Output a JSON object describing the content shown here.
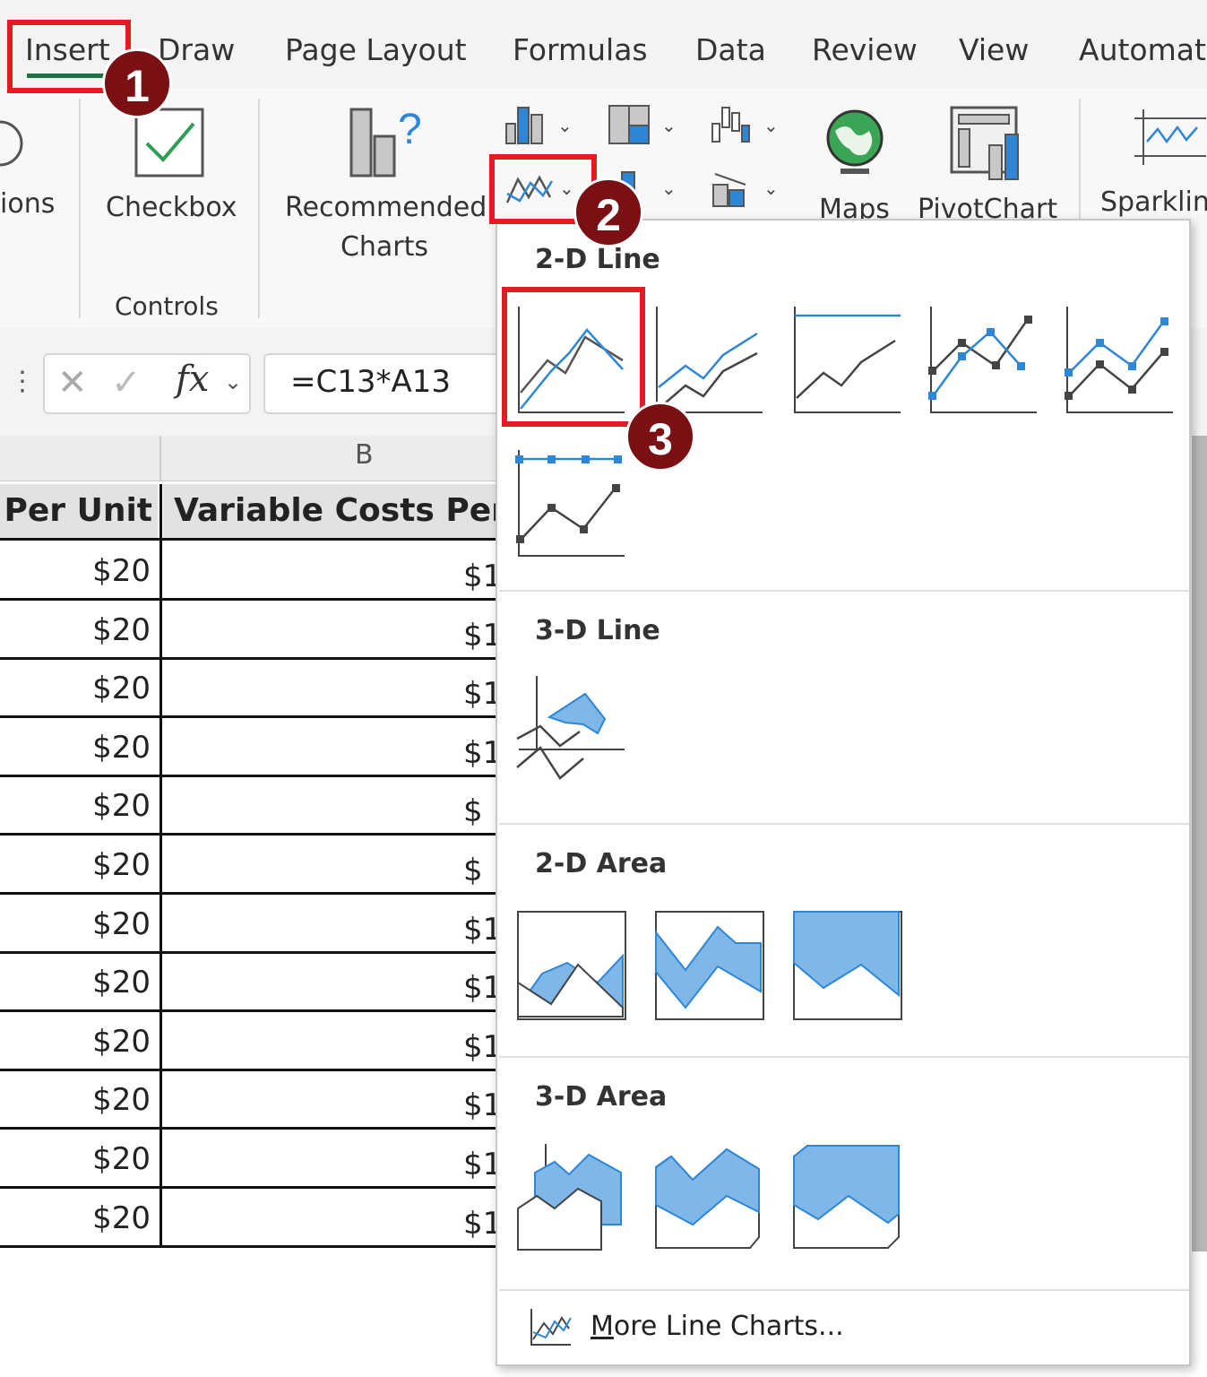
{
  "ribbon_tabs": [
    "Insert",
    "Draw",
    "Page Layout",
    "Formulas",
    "Data",
    "Review",
    "View",
    "Automate"
  ],
  "ribbon": {
    "options_partial": "ions",
    "checkbox_label": "Checkbox",
    "controls_group": "Controls",
    "recommended_line1": "Recommended",
    "recommended_line2": "Charts",
    "maps_label": "Maps",
    "pivotchart_label": "PivotChart",
    "sparklines_label": "Sparklin"
  },
  "formula_bar": {
    "fx": "fx",
    "formula": "=C13*A13"
  },
  "sheet": {
    "col_b_header": "B",
    "header_a": "Per Unit",
    "header_b": "Variable Costs Per U",
    "rows": [
      {
        "a": "$20",
        "b": "$1"
      },
      {
        "a": "$20",
        "b": "$1"
      },
      {
        "a": "$20",
        "b": "$1"
      },
      {
        "a": "$20",
        "b": "$1"
      },
      {
        "a": "$20",
        "b": "$"
      },
      {
        "a": "$20",
        "b": "$"
      },
      {
        "a": "$20",
        "b": "$1"
      },
      {
        "a": "$20",
        "b": "$1"
      },
      {
        "a": "$20",
        "b": "$1"
      },
      {
        "a": "$20",
        "b": "$1"
      },
      {
        "a": "$20",
        "b": "$1"
      },
      {
        "a": "$20",
        "b": "$1"
      }
    ]
  },
  "dropdown": {
    "section_2d_line": "2-D Line",
    "section_3d_line": "3-D Line",
    "section_2d_area": "2-D Area",
    "section_3d_area": "3-D Area",
    "more_prefix": "M",
    "more_rest": "ore Line Charts..."
  },
  "badges": [
    "1",
    "2",
    "3"
  ],
  "colors": {
    "accent_green": "#1e7145",
    "highlight_red": "#e31b23",
    "badge": "#7a0f14",
    "chart_blue": "#2e86d6",
    "area_blue": "#7fb8e8"
  }
}
